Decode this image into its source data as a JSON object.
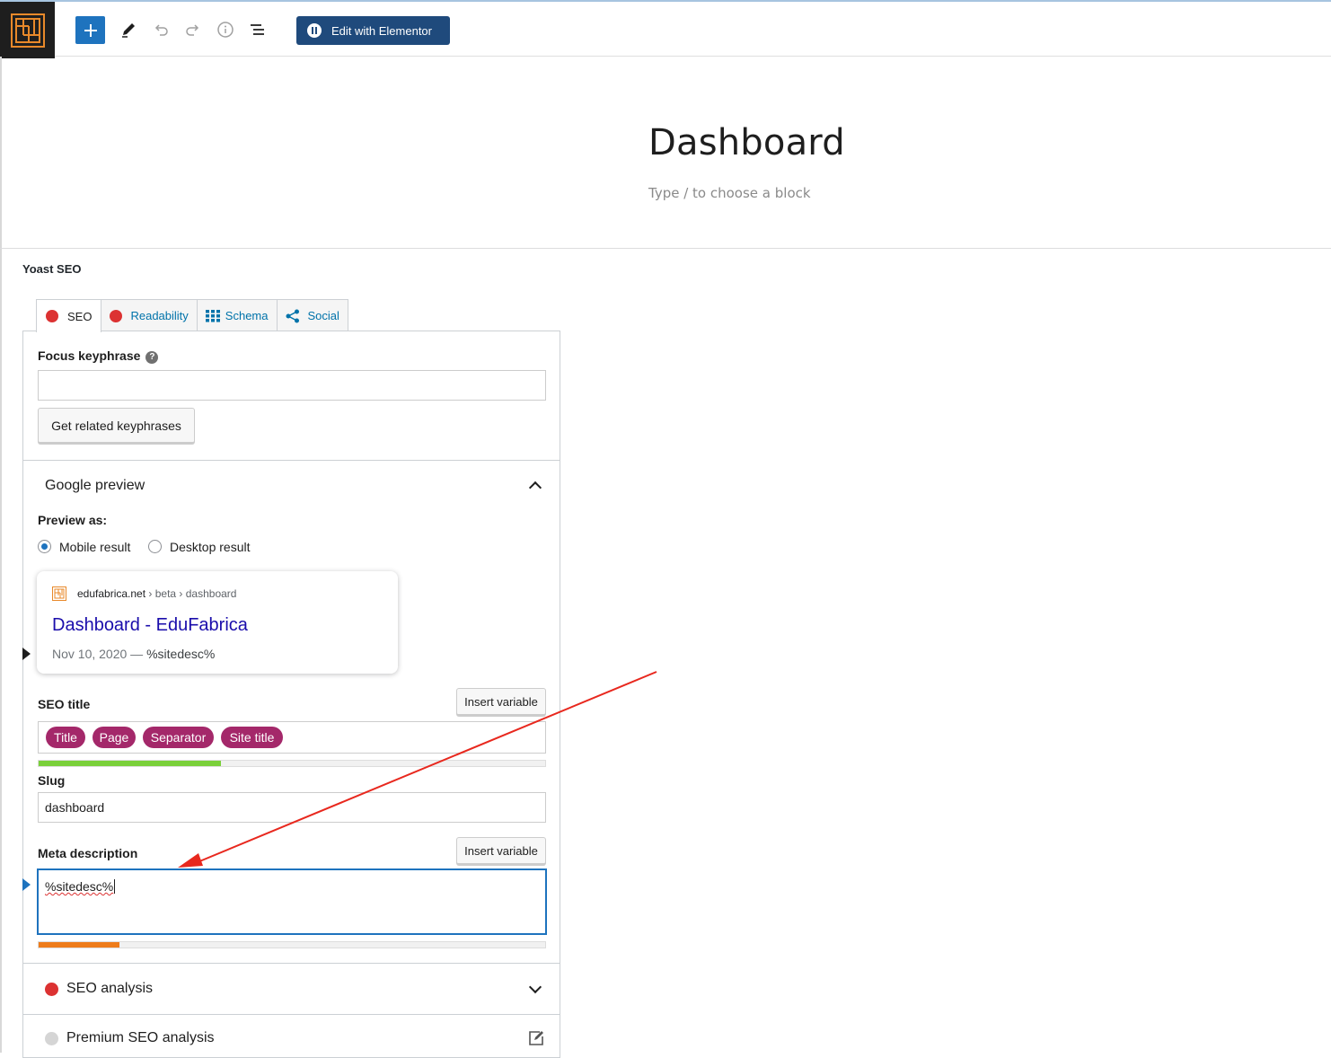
{
  "toolbar": {
    "elementor_label": "Edit with Elementor"
  },
  "editor": {
    "post_title": "Dashboard",
    "block_placeholder": "Type / to choose a block"
  },
  "yoast": {
    "panel_title": "Yoast SEO",
    "tabs": [
      {
        "label": "SEO",
        "status_color": "#dc3232"
      },
      {
        "label": "Readability",
        "status_color": "#dc3232"
      },
      {
        "label": "Schema"
      },
      {
        "label": "Social"
      }
    ],
    "focus_keyphrase": {
      "label": "Focus keyphrase",
      "help": "?",
      "value": "",
      "related_button": "Get related keyphrases"
    },
    "google_preview": {
      "title": "Google preview",
      "preview_as_label": "Preview as:",
      "options": [
        {
          "label": "Mobile result",
          "selected": true
        },
        {
          "label": "Desktop result",
          "selected": false
        }
      ],
      "card": {
        "domain": "edufabrica.net",
        "path": " › beta › dashboard",
        "title": "Dashboard - EduFabrica",
        "date": "Nov 10, 2020",
        "dash": " — ",
        "description": "%sitedesc%"
      }
    },
    "seo_title": {
      "label": "SEO title",
      "insert_variable": "Insert variable",
      "tags": [
        "Title",
        "Page",
        "Separator",
        "Site title"
      ],
      "progress": 0.36,
      "progress_color": "#7ad03a"
    },
    "slug": {
      "label": "Slug",
      "value": "dashboard"
    },
    "meta_description": {
      "label": "Meta description",
      "insert_variable": "Insert variable",
      "value": "%sitedesc%",
      "progress": 0.16,
      "progress_color": "#ee7c1b"
    },
    "seo_analysis": {
      "label": "SEO analysis",
      "status_color": "#dc3232"
    },
    "premium_analysis": {
      "label": "Premium SEO analysis",
      "status_color": "#d5d5d5"
    }
  },
  "colors": {
    "wp_blue": "#1e73be",
    "elementor": "#1f4a7c",
    "tag_purple": "#a4286a",
    "annotation_arrow": "#e8281e"
  }
}
